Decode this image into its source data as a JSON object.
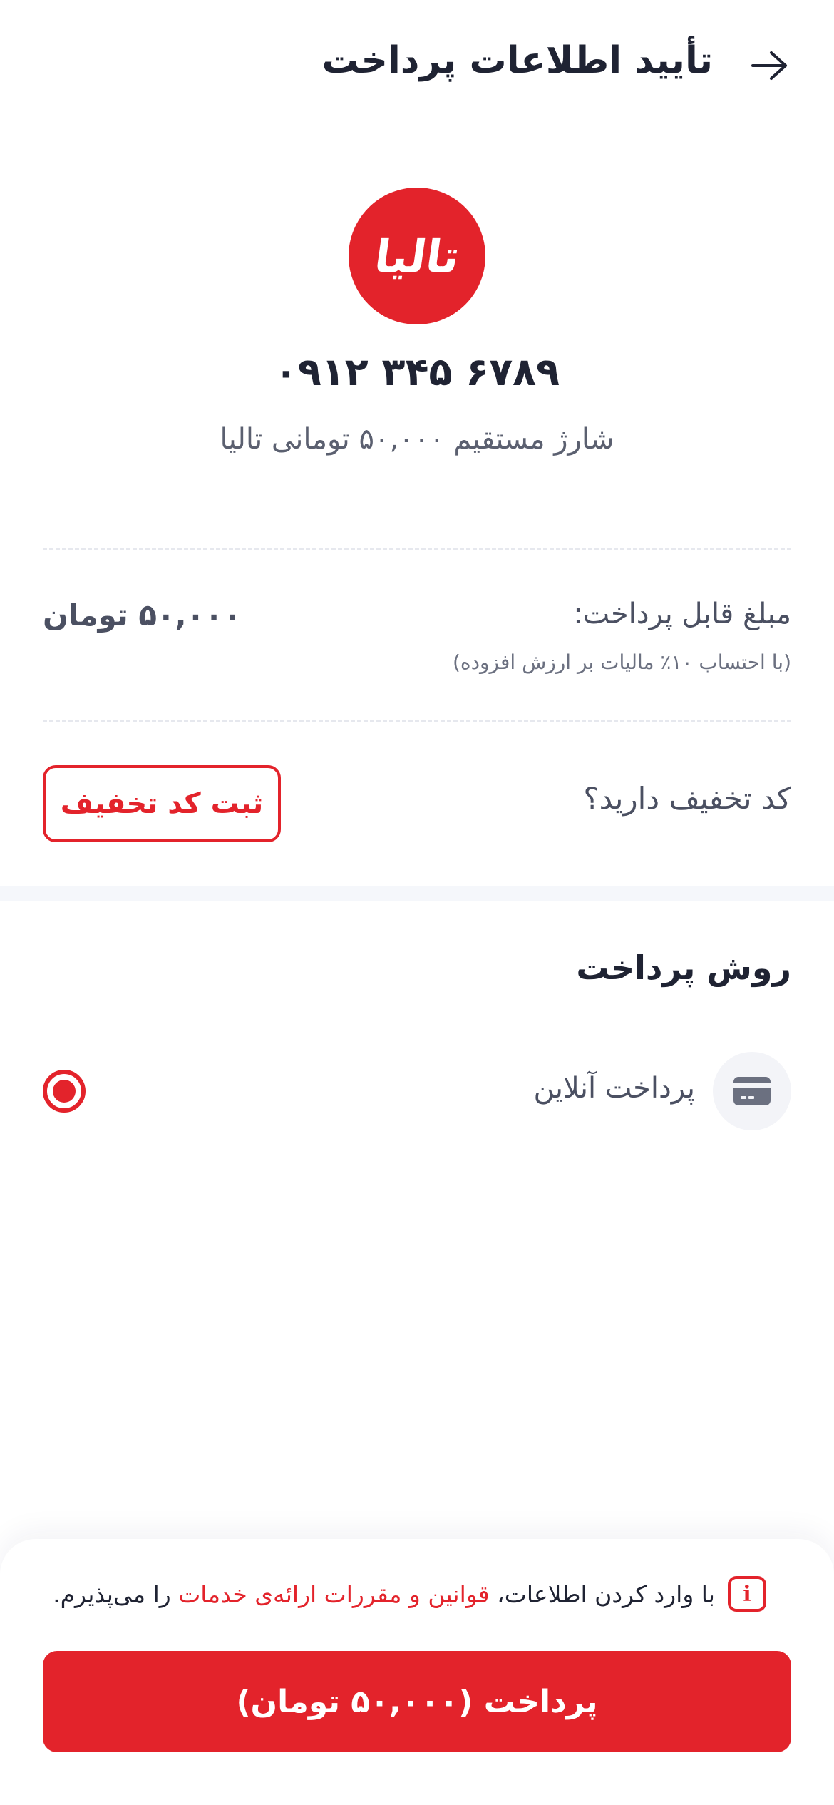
{
  "header": {
    "title": "تأیید اطلاعات پرداخت",
    "back_icon": "arrow-right-icon"
  },
  "operator": {
    "logo_text": "تالیا",
    "brand_color": "#e3232b",
    "phone_number": "۰۹۱۲ ۳۴۵ ۶۷۸۹",
    "product": "شارژ مستقیم ۵۰,۰۰۰ تومانی تالیا"
  },
  "amount": {
    "label": "مبلغ قابل پرداخت:",
    "value": "۵۰,۰۰۰ تومان",
    "tax_note": "(با احتساب ۱۰٪ مالیات بر ارزش افزوده)"
  },
  "discount": {
    "question": "کد تخفیف دارید؟",
    "button_label": "ثبت کد تخفیف"
  },
  "payment_method": {
    "title": "روش پرداخت",
    "options": [
      {
        "label": "پرداخت آنلاین",
        "icon": "credit-card-icon",
        "selected": true
      }
    ]
  },
  "footer": {
    "terms_prefix": "با وارد کردن اطلاعات،",
    "terms_link": "قوانین و مقررات ارائه‌ی خدمات",
    "terms_suffix": "را می‌پذیرم.",
    "info_icon": "info-icon",
    "pay_button_label": "پرداخت (۵۰,۰۰۰ تومان)"
  }
}
